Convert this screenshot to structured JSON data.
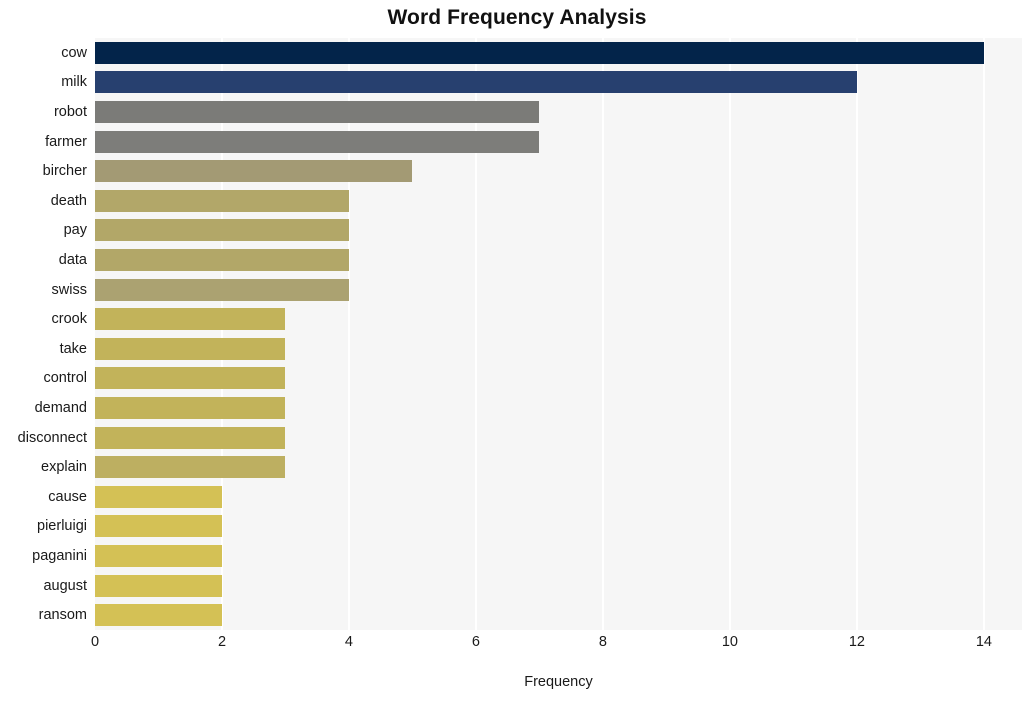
{
  "chart_data": {
    "type": "bar",
    "orientation": "horizontal",
    "title": "Word Frequency Analysis",
    "xlabel": "Frequency",
    "ylabel": "",
    "xlim": [
      0,
      14.6
    ],
    "ylim": [
      0,
      20
    ],
    "xticks": [
      0,
      2,
      4,
      6,
      8,
      10,
      12,
      14
    ],
    "xtick_labels": [
      "0",
      "2",
      "4",
      "6",
      "8",
      "10",
      "12",
      "14"
    ],
    "grid": "vertical",
    "legend": "none",
    "categories": [
      "cow",
      "milk",
      "robot",
      "farmer",
      "bircher",
      "death",
      "pay",
      "data",
      "swiss",
      "crook",
      "take",
      "control",
      "demand",
      "disconnect",
      "explain",
      "cause",
      "pierluigi",
      "paganini",
      "august",
      "ransom"
    ],
    "values": [
      14,
      12,
      7,
      7,
      5,
      4,
      4,
      4,
      4,
      3,
      3,
      3,
      3,
      3,
      3,
      2,
      2,
      2,
      2,
      2
    ],
    "bar_colors": [
      "#03244a",
      "#27406f",
      "#7b7b78",
      "#7d7d7a",
      "#a39a74",
      "#b2a769",
      "#b2a768",
      "#b2a768",
      "#aba271",
      "#c2b35a",
      "#c2b35a",
      "#c2b35a",
      "#c2b35a",
      "#c2b35a",
      "#bdaf61",
      "#d4c155",
      "#d4c155",
      "#d4c155",
      "#d4c155",
      "#d4c155"
    ],
    "plot_background": "#f6f6f6",
    "figure_background": "#ffffff",
    "gridline_color": "#ffffff",
    "title_color": "#111111",
    "tick_color": "#1a1a1a"
  }
}
